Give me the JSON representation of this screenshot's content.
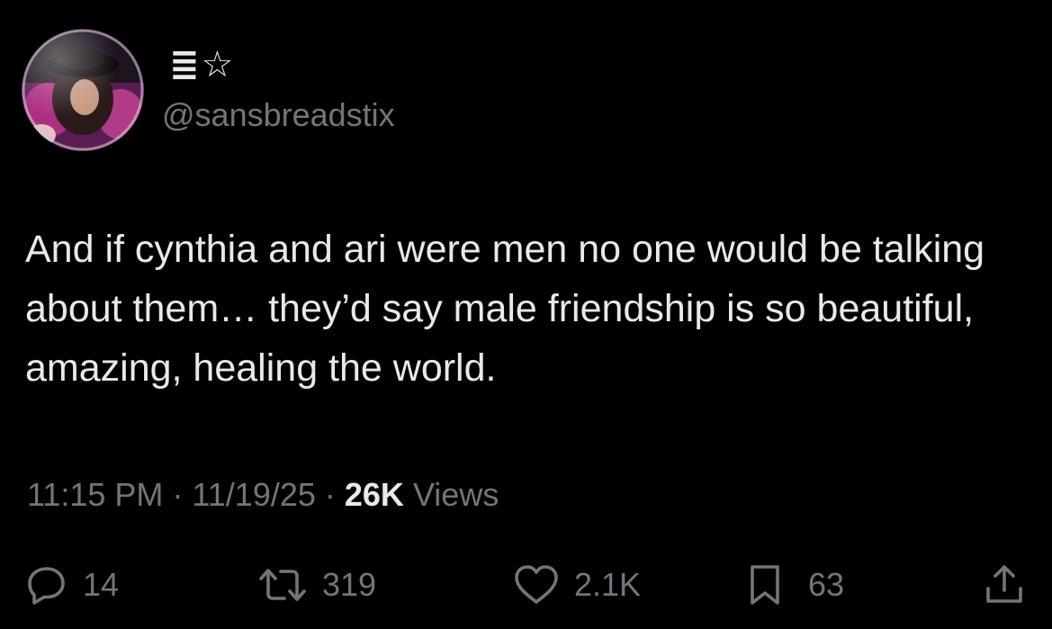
{
  "user": {
    "display_name": "≣☆",
    "handle": "@sansbreadstix"
  },
  "tweet": {
    "text": "And if cynthia and ari were men no one would be talking about them… they’d say male friendship is so beautiful, amazing, healing the world."
  },
  "meta": {
    "time": "11:15 PM",
    "separator": " · ",
    "date": "11/19/25",
    "views_count": "26K",
    "views_label": " Views"
  },
  "actions": {
    "replies": "14",
    "reposts": "319",
    "likes": "2.1K",
    "bookmarks": "63"
  },
  "icons": {
    "reply": "reply-icon",
    "repost": "repost-icon",
    "like": "like-icon",
    "bookmark": "bookmark-icon",
    "share": "share-icon"
  },
  "colors": {
    "background": "#000000",
    "text": "#e7e9ea",
    "secondary": "#71767b"
  }
}
